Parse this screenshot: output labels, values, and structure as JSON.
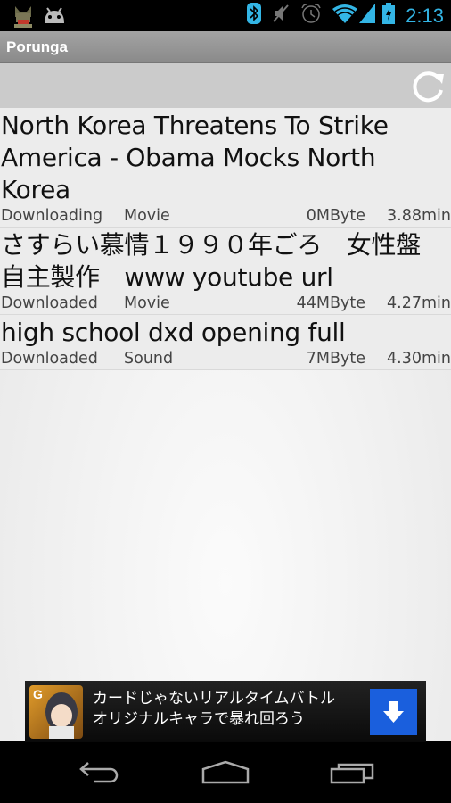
{
  "status_bar": {
    "time": "2:13",
    "left_icons": [
      "cat-avatar-icon",
      "android-icon"
    ],
    "right_icons": [
      "bluetooth-icon",
      "mute-icon",
      "alarm-icon",
      "wifi-icon",
      "signal-icon",
      "battery-charging-icon"
    ]
  },
  "app": {
    "title": "Porunga"
  },
  "toolbar": {
    "refresh_icon": "refresh-icon"
  },
  "downloads": [
    {
      "title": "North Korea Threatens To Strike America - Obama Mocks North Korea",
      "status": "Downloading",
      "type": "Movie",
      "size": "0MByte",
      "duration": "3.88min"
    },
    {
      "title": "さすらい慕情１９９０年ごろ　女性盤　自主製作　www youtube url",
      "status": "Downloaded",
      "type": "Movie",
      "size": "44MByte",
      "duration": "4.27min"
    },
    {
      "title": "high school dxd opening full",
      "status": "Downloaded",
      "type": "Sound",
      "size": "7MByte",
      "duration": "4.30min"
    }
  ],
  "ad": {
    "line1": "カードじゃないリアルタイムバトル",
    "line2": "オリジナルキャラで暴れ回ろう",
    "badge": "G",
    "button_icon": "download-arrow-icon",
    "button_color": "#1a5fdd"
  },
  "nav_bar": {
    "buttons": [
      "back",
      "home",
      "recent-apps"
    ]
  },
  "colors": {
    "status_accent": "#33b5e5",
    "title_bar": "#999999",
    "toolbar": "#cbcbcb"
  }
}
